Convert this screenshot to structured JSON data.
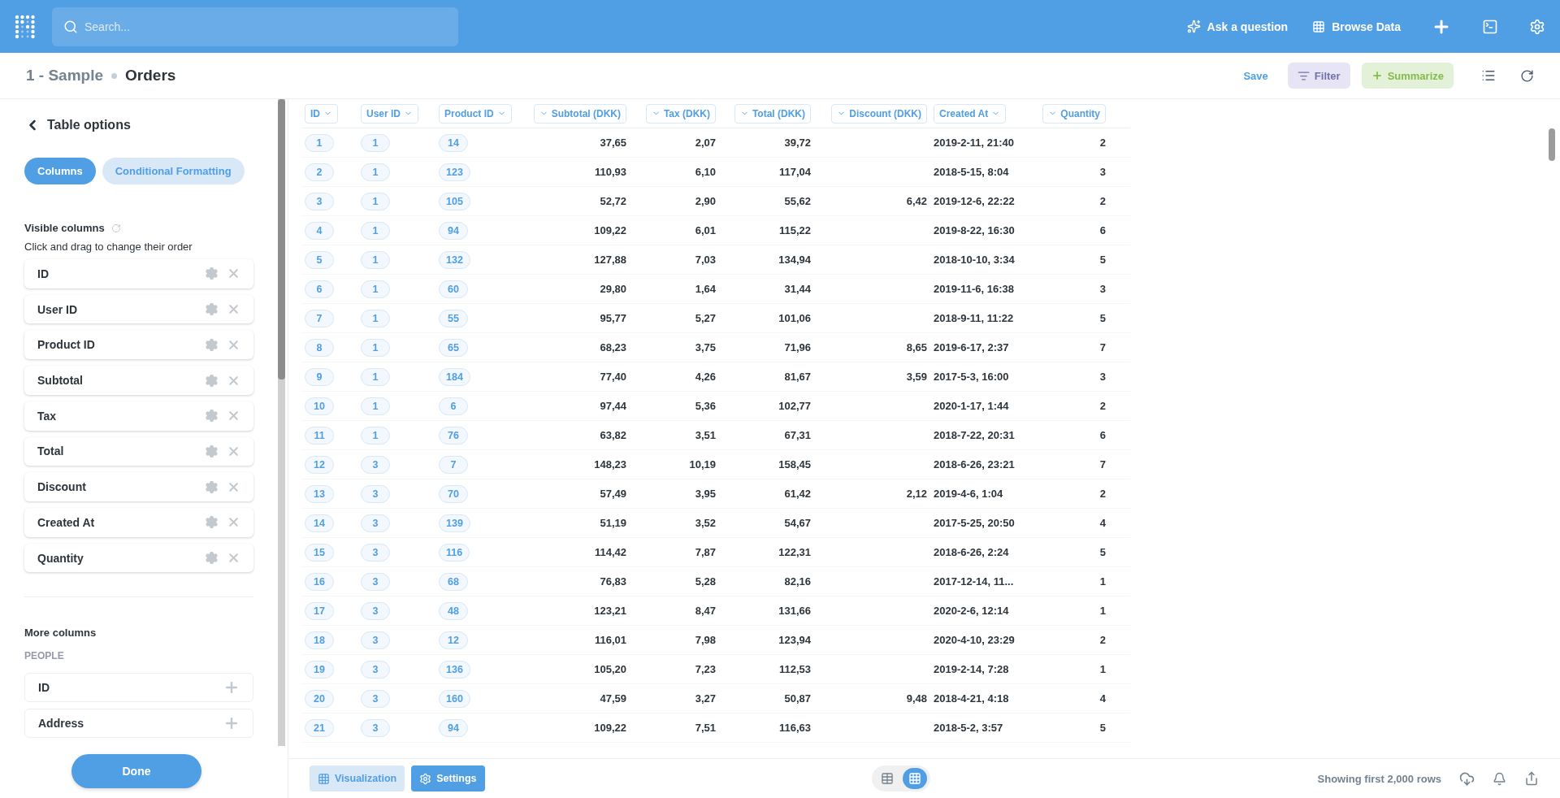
{
  "topbar": {
    "search": {
      "placeholder": "Search..."
    },
    "actions": [
      {
        "kind": "ask",
        "label": "Ask a question"
      },
      {
        "kind": "browse",
        "label": "Browse Data"
      }
    ]
  },
  "header": {
    "collection": "1 - Sample",
    "title": "Orders",
    "save": "Save",
    "filter": "Filter",
    "summarize": "Summarize"
  },
  "sidebar": {
    "title": "Table options",
    "tabs": [
      {
        "label": "Columns",
        "selected": true
      },
      {
        "label": "Conditional Formatting",
        "selected": false
      }
    ],
    "visible_heading": "Visible columns",
    "hint": "Click and drag to change their order",
    "visible_columns": [
      "ID",
      "User ID",
      "Product ID",
      "Subtotal",
      "Tax",
      "Total",
      "Discount",
      "Created At",
      "Quantity"
    ],
    "more_heading": "More columns",
    "group": "PEOPLE",
    "more_columns": [
      "ID",
      "Address"
    ],
    "done": "Done"
  },
  "table": {
    "columns": [
      {
        "label": "ID",
        "kind": "link"
      },
      {
        "label": "User ID",
        "kind": "link"
      },
      {
        "label": "Product ID",
        "kind": "link"
      },
      {
        "label": "Subtotal (DKK)",
        "kind": "number"
      },
      {
        "label": "Tax (DKK)",
        "kind": "number"
      },
      {
        "label": "Total (DKK)",
        "kind": "number"
      },
      {
        "label": "Discount (DKK)",
        "kind": "number"
      },
      {
        "label": "Created At",
        "kind": "date"
      },
      {
        "label": "Quantity",
        "kind": "number"
      }
    ],
    "rows": [
      [
        "1",
        "1",
        "14",
        "37,65",
        "2,07",
        "39,72",
        null,
        "2019-2-11, 21:40",
        "2"
      ],
      [
        "2",
        "1",
        "123",
        "110,93",
        "6,10",
        "117,04",
        null,
        "2018-5-15, 8:04",
        "3"
      ],
      [
        "3",
        "1",
        "105",
        "52,72",
        "2,90",
        "55,62",
        "6,42",
        "2019-12-6, 22:22",
        "2"
      ],
      [
        "4",
        "1",
        "94",
        "109,22",
        "6,01",
        "115,22",
        null,
        "2019-8-22, 16:30",
        "6"
      ],
      [
        "5",
        "1",
        "132",
        "127,88",
        "7,03",
        "134,94",
        null,
        "2018-10-10, 3:34",
        "5"
      ],
      [
        "6",
        "1",
        "60",
        "29,80",
        "1,64",
        "31,44",
        null,
        "2019-11-6, 16:38",
        "3"
      ],
      [
        "7",
        "1",
        "55",
        "95,77",
        "5,27",
        "101,06",
        null,
        "2018-9-11, 11:22",
        "5"
      ],
      [
        "8",
        "1",
        "65",
        "68,23",
        "3,75",
        "71,96",
        "8,65",
        "2019-6-17, 2:37",
        "7"
      ],
      [
        "9",
        "1",
        "184",
        "77,40",
        "4,26",
        "81,67",
        "3,59",
        "2017-5-3, 16:00",
        "3"
      ],
      [
        "10",
        "1",
        "6",
        "97,44",
        "5,36",
        "102,77",
        null,
        "2020-1-17, 1:44",
        "2"
      ],
      [
        "11",
        "1",
        "76",
        "63,82",
        "3,51",
        "67,31",
        null,
        "2018-7-22, 20:31",
        "6"
      ],
      [
        "12",
        "3",
        "7",
        "148,23",
        "10,19",
        "158,45",
        null,
        "2018-6-26, 23:21",
        "7"
      ],
      [
        "13",
        "3",
        "70",
        "57,49",
        "3,95",
        "61,42",
        "2,12",
        "2019-4-6, 1:04",
        "2"
      ],
      [
        "14",
        "3",
        "139",
        "51,19",
        "3,52",
        "54,67",
        null,
        "2017-5-25, 20:50",
        "4"
      ],
      [
        "15",
        "3",
        "116",
        "114,42",
        "7,87",
        "122,31",
        null,
        "2018-6-26, 2:24",
        "5"
      ],
      [
        "16",
        "3",
        "68",
        "76,83",
        "5,28",
        "82,16",
        null,
        "2017-12-14, 11...",
        "1"
      ],
      [
        "17",
        "3",
        "48",
        "123,21",
        "8,47",
        "131,66",
        null,
        "2020-2-6, 12:14",
        "1"
      ],
      [
        "18",
        "3",
        "12",
        "116,01",
        "7,98",
        "123,94",
        null,
        "2020-4-10, 23:29",
        "2"
      ],
      [
        "19",
        "3",
        "136",
        "105,20",
        "7,23",
        "112,53",
        null,
        "2019-2-14, 7:28",
        "1"
      ],
      [
        "20",
        "3",
        "160",
        "47,59",
        "3,27",
        "50,87",
        "9,48",
        "2018-4-21, 4:18",
        "4"
      ],
      [
        "21",
        "3",
        "94",
        "109,22",
        "7,51",
        "116,63",
        null,
        "2018-5-2, 3:57",
        "5"
      ]
    ]
  },
  "footer": {
    "visualization": "Visualization",
    "settings": "Settings",
    "views": [
      {
        "kind": "table",
        "selected": false
      },
      {
        "kind": "grid",
        "selected": true
      }
    ],
    "row_count": "Showing first 2,000 rows"
  }
}
